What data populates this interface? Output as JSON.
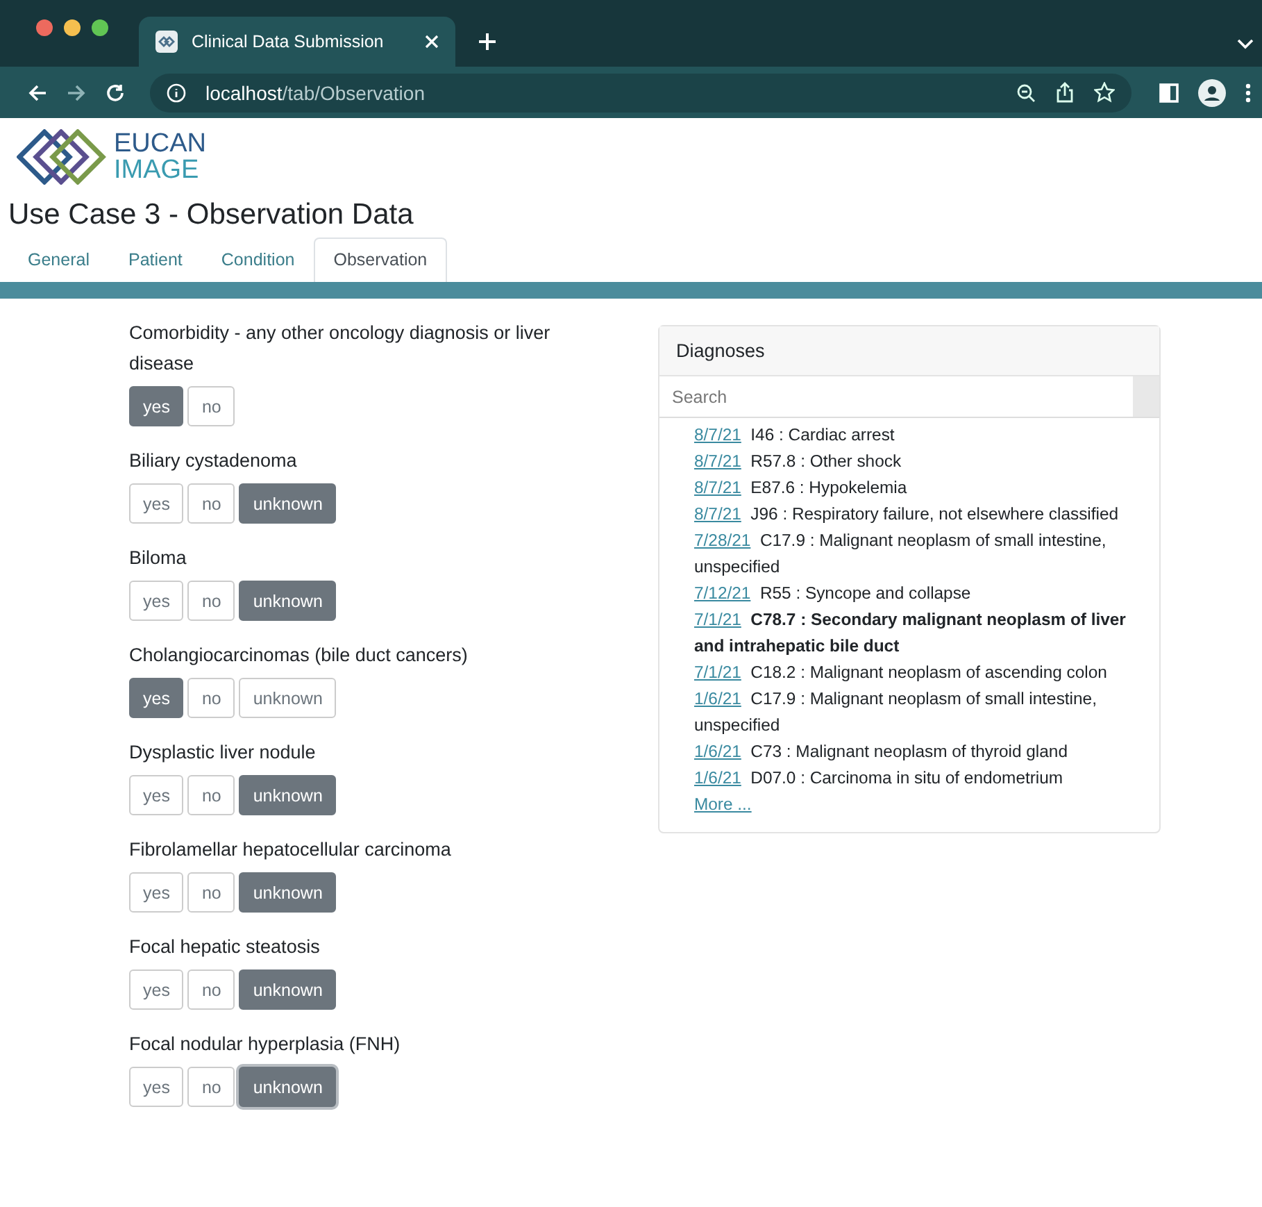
{
  "browser": {
    "tab_title": "Clinical Data Submission",
    "address": "**localhost**/tab/Observation"
  },
  "logo": {
    "line1": "EUCAN",
    "line2": "IMAGE"
  },
  "heading": "Use Case 3 - Observation Data",
  "tabs": [
    {
      "label": "General",
      "selected": false
    },
    {
      "label": "Patient",
      "selected": false
    },
    {
      "label": "Condition",
      "selected": false
    },
    {
      "label": "Observation",
      "selected": true
    }
  ],
  "questions": [
    {
      "label": "Comorbidity - any other oncology diagnosis or liver disease",
      "options": [
        {
          "label": "yes",
          "selected": true,
          "focused": false
        },
        {
          "label": "no",
          "selected": false,
          "focused": false
        }
      ]
    },
    {
      "label": "Biliary cystadenoma",
      "options": [
        {
          "label": "yes",
          "selected": false,
          "focused": false
        },
        {
          "label": "no",
          "selected": false,
          "focused": false
        },
        {
          "label": "unknown",
          "selected": true,
          "focused": false
        }
      ]
    },
    {
      "label": "Biloma",
      "options": [
        {
          "label": "yes",
          "selected": false,
          "focused": false
        },
        {
          "label": "no",
          "selected": false,
          "focused": false
        },
        {
          "label": "unknown",
          "selected": true,
          "focused": false
        }
      ]
    },
    {
      "label": "Cholangiocarcinomas (bile duct cancers)",
      "options": [
        {
          "label": "yes",
          "selected": true,
          "focused": false
        },
        {
          "label": "no",
          "selected": false,
          "focused": false
        },
        {
          "label": "unknown",
          "selected": false,
          "focused": false
        }
      ]
    },
    {
      "label": "Dysplastic liver nodule",
      "options": [
        {
          "label": "yes",
          "selected": false,
          "focused": false
        },
        {
          "label": "no",
          "selected": false,
          "focused": false
        },
        {
          "label": "unknown",
          "selected": true,
          "focused": false
        }
      ]
    },
    {
      "label": "Fibrolamellar hepatocellular carcinoma",
      "options": [
        {
          "label": "yes",
          "selected": false,
          "focused": false
        },
        {
          "label": "no",
          "selected": false,
          "focused": false
        },
        {
          "label": "unknown",
          "selected": true,
          "focused": false
        }
      ]
    },
    {
      "label": "Focal hepatic steatosis",
      "options": [
        {
          "label": "yes",
          "selected": false,
          "focused": false
        },
        {
          "label": "no",
          "selected": false,
          "focused": false
        },
        {
          "label": "unknown",
          "selected": true,
          "focused": false
        }
      ]
    },
    {
      "label": "Focal nodular hyperplasia (FNH)",
      "options": [
        {
          "label": "yes",
          "selected": false,
          "focused": false
        },
        {
          "label": "no",
          "selected": false,
          "focused": false
        },
        {
          "label": "unknown",
          "selected": true,
          "focused": true
        }
      ]
    }
  ],
  "diagnoses": {
    "title": "Diagnoses",
    "search": {
      "placeholder": "Search"
    },
    "items": [
      {
        "date": "8/7/21",
        "text": "I46 : Cardiac arrest",
        "bold": false
      },
      {
        "date": "8/7/21",
        "text": "R57.8 : Other shock",
        "bold": false
      },
      {
        "date": "8/7/21",
        "text": "E87.6 : Hypokelemia",
        "bold": false
      },
      {
        "date": "8/7/21",
        "text": "J96 : Respiratory failure, not elsewhere classified",
        "bold": false
      },
      {
        "date": "7/28/21",
        "text": "C17.9 : Malignant neoplasm of small intestine, unspecified",
        "bold": false
      },
      {
        "date": "7/12/21",
        "text": "R55 : Syncope and collapse",
        "bold": false
      },
      {
        "date": "7/1/21",
        "text": "C78.7 : Secondary malignant neoplasm of liver and intrahepatic bile duct",
        "bold": true
      },
      {
        "date": "7/1/21",
        "text": "C18.2 : Malignant neoplasm of ascending colon",
        "bold": false
      },
      {
        "date": "1/6/21",
        "text": "C17.9 : Malignant neoplasm of small intestine, unspecified",
        "bold": false
      },
      {
        "date": "1/6/21",
        "text": "C73 : Malignant neoplasm of thyroid gland",
        "bold": false
      },
      {
        "date": "1/6/21",
        "text": "D07.0 : Carcinoma in situ of endometrium",
        "bold": false
      }
    ],
    "more": "More ..."
  }
}
